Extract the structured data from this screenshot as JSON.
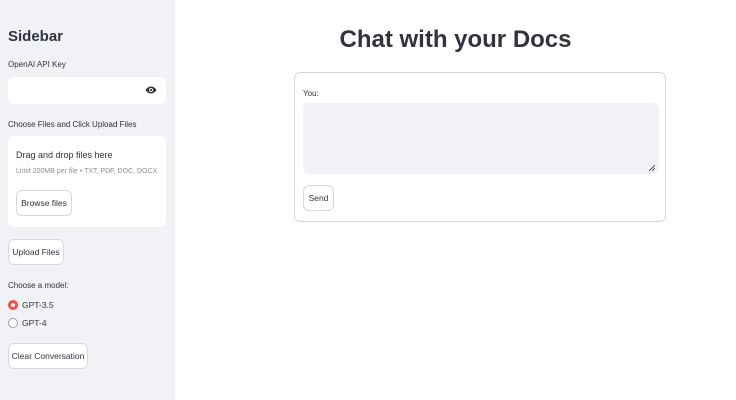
{
  "sidebar": {
    "title": "Sidebar",
    "api_key": {
      "label": "OpenAI API Key",
      "value": "",
      "toggle_icon": "eye-icon"
    },
    "upload_label": "Choose Files and Click Upload Files",
    "dropzone": {
      "title": "Drag and drop files here",
      "limit": "Limit 200MB per file • TXT, PDF, DOC, DOCX",
      "browse_label": "Browse files"
    },
    "upload_button": "Upload Files",
    "model": {
      "label": "Choose a model:",
      "options": [
        {
          "label": "GPT-3.5",
          "selected": true
        },
        {
          "label": "GPT-4",
          "selected": false
        }
      ]
    },
    "clear_button": "Clear Conversation"
  },
  "main": {
    "title": "Chat with your Docs",
    "chat": {
      "input_label": "You:",
      "input_value": "",
      "send_button": "Send"
    }
  },
  "colors": {
    "accent": "#ff4b4b",
    "sidebar_bg": "#f0f2f6",
    "text": "#31333f"
  }
}
